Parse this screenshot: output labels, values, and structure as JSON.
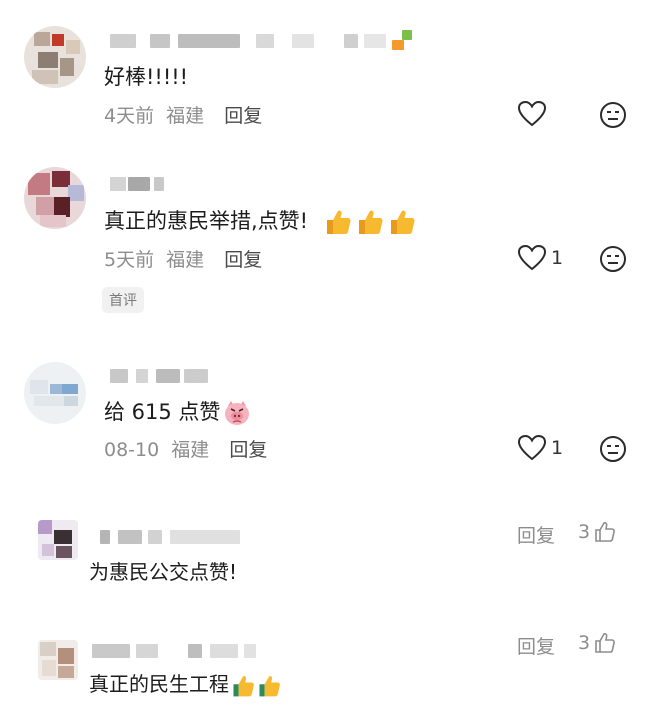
{
  "comments": [
    {
      "text": "好棒!!!!!",
      "time": "4天前",
      "location": "福建",
      "reply_label": "回复",
      "like_count": ""
    },
    {
      "text": "真正的惠民举措,点赞!",
      "time": "5天前",
      "location": "福建",
      "reply_label": "回复",
      "like_count": "1",
      "badge": "首评",
      "emoji_icons": [
        "thumbs-up-icon",
        "thumbs-up-icon",
        "thumbs-up-icon"
      ]
    },
    {
      "text": "给 615 点赞",
      "time": "08-10",
      "location": "福建",
      "reply_label": "回复",
      "like_count": "1",
      "emoji_icons": [
        "pig-face-icon"
      ]
    }
  ],
  "replies": [
    {
      "text": "为惠民公交点赞!",
      "reply_label": "回复",
      "like_count": "3"
    },
    {
      "text": "真正的民生工程",
      "reply_label": "回复",
      "like_count": "3",
      "emoji_icons": [
        "thumbs-up-icon",
        "thumbs-up-icon"
      ]
    }
  ],
  "colors": {
    "meta_text": "#8d8d8d",
    "body_text": "#1c1c1c",
    "badge_bg": "#f1f1f1",
    "thumb": "#f5b524"
  }
}
